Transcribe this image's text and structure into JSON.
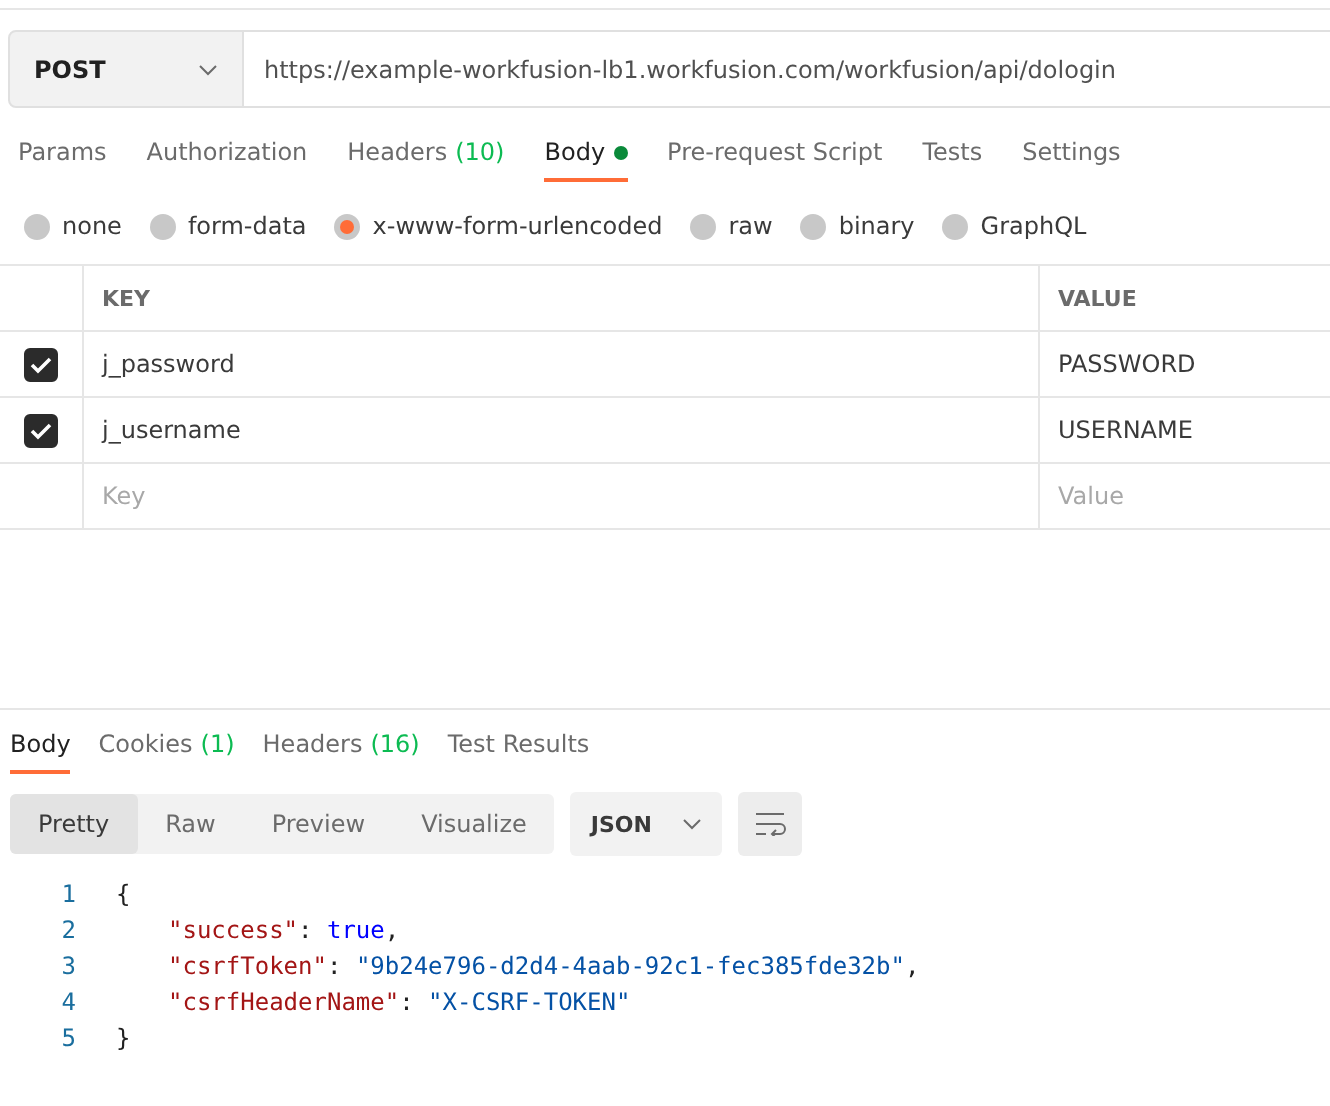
{
  "request": {
    "method": "POST",
    "url": "https://example-workfusion-lb1.workfusion.com/workfusion/api/dologin"
  },
  "request_tabs": [
    {
      "label": "Params",
      "selected": false,
      "has_content": false
    },
    {
      "label": "Authorization",
      "selected": false,
      "has_content": false
    },
    {
      "label": "Headers",
      "count": "(10)",
      "selected": false,
      "has_content": false
    },
    {
      "label": "Body",
      "selected": true,
      "has_content": true
    },
    {
      "label": "Pre-request Script",
      "selected": false,
      "has_content": false
    },
    {
      "label": "Tests",
      "selected": false,
      "has_content": false
    },
    {
      "label": "Settings",
      "selected": false,
      "has_content": false
    }
  ],
  "body_types": [
    {
      "label": "none",
      "selected": false
    },
    {
      "label": "form-data",
      "selected": false
    },
    {
      "label": "x-www-form-urlencoded",
      "selected": true
    },
    {
      "label": "raw",
      "selected": false
    },
    {
      "label": "binary",
      "selected": false
    },
    {
      "label": "GraphQL",
      "selected": false
    }
  ],
  "params_table": {
    "columns": [
      "KEY",
      "VALUE"
    ],
    "rows": [
      {
        "key": "j_password",
        "value": "PASSWORD",
        "checked": true
      },
      {
        "key": "j_username",
        "value": "USERNAME",
        "checked": true
      }
    ],
    "new_row": {
      "key_placeholder": "Key",
      "value_placeholder": "Value"
    }
  },
  "response_tabs": [
    {
      "label": "Body",
      "selected": true
    },
    {
      "label": "Cookies",
      "count": "(1)",
      "selected": false
    },
    {
      "label": "Headers",
      "count": "(16)",
      "selected": false
    },
    {
      "label": "Test Results",
      "selected": false
    }
  ],
  "view_modes": [
    {
      "label": "Pretty",
      "selected": true
    },
    {
      "label": "Raw",
      "selected": false
    },
    {
      "label": "Preview",
      "selected": false
    },
    {
      "label": "Visualize",
      "selected": false
    }
  ],
  "format": "JSON",
  "code_lines": [
    {
      "number": "1",
      "tokens": [
        {
          "kind": "punct",
          "text": "{"
        }
      ]
    },
    {
      "number": "2",
      "tokens": [
        {
          "kind": "key",
          "text": "\"success\""
        },
        {
          "kind": "punct",
          "text": ": "
        },
        {
          "kind": "bool",
          "text": "true"
        },
        {
          "kind": "punct",
          "text": ","
        }
      ]
    },
    {
      "number": "3",
      "tokens": [
        {
          "kind": "key",
          "text": "\"csrfToken\""
        },
        {
          "kind": "punct",
          "text": ": "
        },
        {
          "kind": "string",
          "text": "\"9b24e796-d2d4-4aab-92c1-fec385fde32b\""
        },
        {
          "kind": "punct",
          "text": ","
        }
      ]
    },
    {
      "number": "4",
      "tokens": [
        {
          "kind": "key",
          "text": "\"csrfHeaderName\""
        },
        {
          "kind": "punct",
          "text": ": "
        },
        {
          "kind": "string",
          "text": "\"X-CSRF-TOKEN\""
        }
      ]
    },
    {
      "number": "5",
      "tokens": [
        {
          "kind": "punct",
          "text": "}"
        }
      ]
    }
  ]
}
